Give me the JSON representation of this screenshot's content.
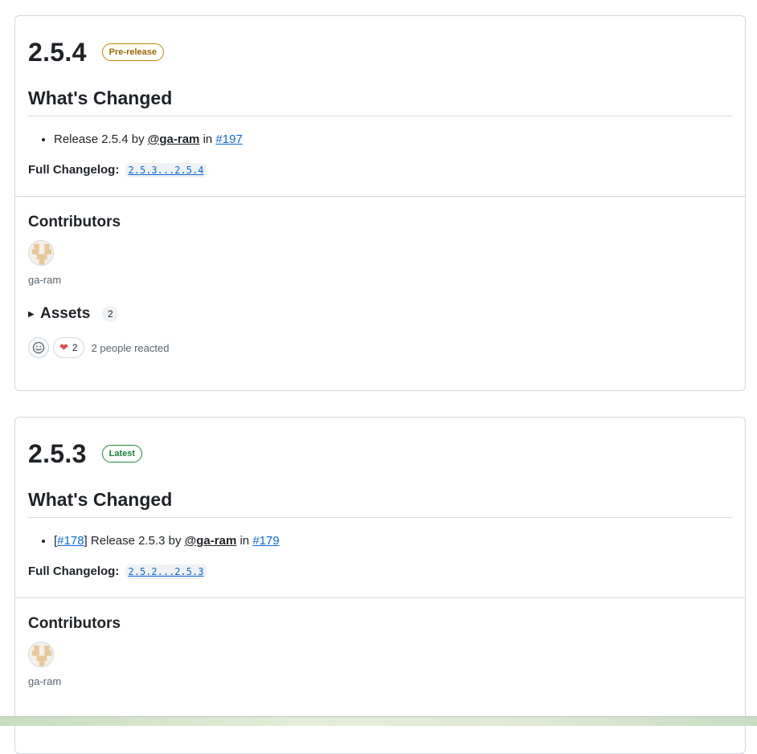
{
  "releases": [
    {
      "version": "2.5.4",
      "badge": "Pre-release",
      "section_title": "What's Changed",
      "change": {
        "prefix_open": "",
        "issue": "",
        "prefix_close": "",
        "text": "Release 2.5.4 by ",
        "user": "@ga-ram",
        "in": " in ",
        "pr": "#197"
      },
      "full_changelog_label": "Full Changelog",
      "full_changelog_colon": ":",
      "full_changelog_link": "2.5.3...2.5.4",
      "contributors_title": "Contributors",
      "contributor_name": "ga-ram",
      "assets_label": "Assets",
      "assets_count": "2",
      "heart_count": "2",
      "reactions_text": "2 people reacted"
    },
    {
      "version": "2.5.3",
      "badge": "Latest",
      "section_title": "What's Changed",
      "change": {
        "prefix_open": "[",
        "issue": "#178",
        "prefix_close": "] ",
        "text": "Release 2.5.3 by ",
        "user": "@ga-ram",
        "in": " in ",
        "pr": "#179"
      },
      "full_changelog_label": "Full Changelog",
      "full_changelog_colon": ":",
      "full_changelog_link": "2.5.2...2.5.3",
      "contributors_title": "Contributors",
      "contributor_name": "ga-ram"
    }
  ],
  "icons": {
    "smiley": "smiley-icon",
    "heart": "heart-icon",
    "caret": "triangle-right-icon",
    "avatar": "identicon-avatar"
  },
  "colors": {
    "link": "#0969da",
    "prerelease": "#9a6700",
    "latest": "#1a7f37",
    "heart": "#e5484d",
    "avatar_fill": "#e7c79a"
  }
}
